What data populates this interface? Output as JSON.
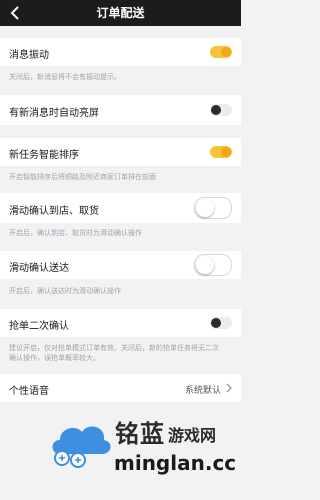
{
  "header": {
    "title": "订单配送",
    "back_icon": "back-arrow-icon"
  },
  "settings": [
    {
      "label": "消息振动",
      "hint": "关闭后，新消息将不会有振动提示。",
      "state": "on"
    },
    {
      "label": "有新消息时自动亮屏",
      "hint": "",
      "state": "off"
    },
    {
      "label": "新任务智能排序",
      "hint": "开启智能排序后将顺路及附近商家订单排在前面",
      "state": "on"
    },
    {
      "label": "滑动确认到店、取货",
      "hint": "开启后，确认到店、取货时为滑动确认操作",
      "state": "off"
    },
    {
      "label": "滑动确认送达",
      "hint": "开启后，确认送达时为滑动确认操作",
      "state": "off"
    },
    {
      "label": "抢单二次确认",
      "hint_line1": "建议开启，仅对抢单模式订单有效。关闭后，新的抢单任务将无二次",
      "hint_line2": "确认操作，误抢单概率较大。",
      "state": "off"
    }
  ],
  "voice": {
    "label": "个性语音",
    "value": "系统默认",
    "icon": "chevron-right-icon"
  },
  "watermark": {
    "title": "铭蓝",
    "sub": "游戏网",
    "url": "minglan.cc"
  },
  "colors": {
    "accent": "#f5c23a",
    "header_bg": "#1c1c1e",
    "page_bg": "#f2f2f4"
  }
}
